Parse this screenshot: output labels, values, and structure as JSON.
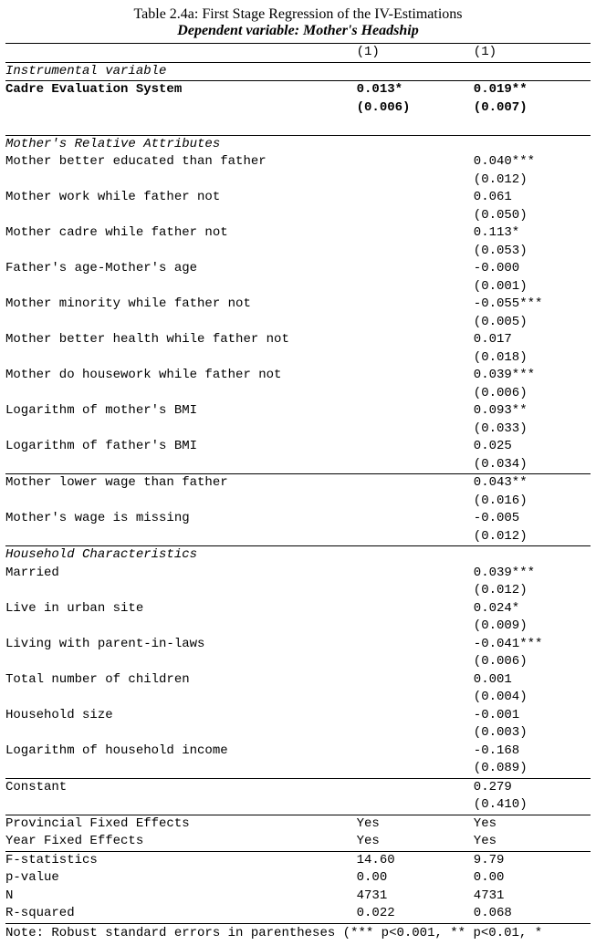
{
  "header": {
    "title": "Table 2.4a: First Stage Regression of the IV-Estimations",
    "subtitle": "Dependent variable: Mother's Headship"
  },
  "cols": {
    "c1": "(1)",
    "c2": "(1)"
  },
  "iv": {
    "heading": "Instrumental variable",
    "row": {
      "label": "Cadre Evaluation System",
      "v1": "0.013*",
      "v2": "0.019**",
      "se1": "(0.006)",
      "se2": "(0.007)"
    }
  },
  "relattr": {
    "heading": "Mother's Relative Attributes",
    "rows": [
      {
        "label": "Mother better educated than father",
        "v2": "0.040***",
        "se2": "(0.012)"
      },
      {
        "label": "Mother work while father not",
        "v2": "0.061",
        "se2": "(0.050)"
      },
      {
        "label": "Mother cadre while father not",
        "v2": "0.113*",
        "se2": "(0.053)"
      },
      {
        "label": "Father's age-Mother's age",
        "v2": "-0.000",
        "se2": "(0.001)"
      },
      {
        "label": "Mother minority while father not",
        "v2": "-0.055***",
        "se2": "(0.005)"
      },
      {
        "label": "Mother better health while father not",
        "v2": "0.017",
        "se2": "(0.018)"
      },
      {
        "label": "Mother do housework while father not",
        "v2": "0.039***",
        "se2": "(0.006)"
      },
      {
        "label": "Logarithm of mother's BMI",
        "v2": "0.093**",
        "se2": "(0.033)"
      },
      {
        "label": "Logarithm of father's BMI",
        "v2": "0.025",
        "se2": "(0.034)"
      }
    ]
  },
  "wage": {
    "rows": [
      {
        "label": "Mother lower wage than father",
        "v2": "0.043**",
        "se2": "(0.016)"
      },
      {
        "label": "Mother's wage is missing",
        "v2": "-0.005",
        "se2": "(0.012)"
      }
    ]
  },
  "hh": {
    "heading": "Household Characteristics",
    "rows": [
      {
        "label": "Married",
        "v2": "0.039***",
        "se2": "(0.012)"
      },
      {
        "label": "Live in urban site",
        "v2": "0.024*",
        "se2": "(0.009)"
      },
      {
        "label": "Living with parent-in-laws",
        "v2": "-0.041***",
        "se2": "(0.006)"
      },
      {
        "label": "Total number of children",
        "v2": "0.001",
        "se2": "(0.004)"
      },
      {
        "label": "Household size",
        "v2": "-0.001",
        "se2": "(0.003)"
      },
      {
        "label": "Logarithm of household income",
        "v2": "-0.168",
        "se2": "(0.089)"
      }
    ]
  },
  "constant": {
    "label": "Constant",
    "v2": "0.279",
    "se2": "(0.410)"
  },
  "fe": {
    "rows": [
      {
        "label": "Provincial Fixed Effects",
        "v1": "Yes",
        "v2": "Yes"
      },
      {
        "label": "Year Fixed Effects",
        "v1": "Yes",
        "v2": "Yes"
      }
    ]
  },
  "stats": {
    "rows": [
      {
        "label": "F-statistics",
        "v1": "14.60",
        "v2": "9.79"
      },
      {
        "label": "p-value",
        "v1": "0.00",
        "v2": "0.00"
      },
      {
        "label": "N",
        "v1": "4731",
        "v2": "4731"
      },
      {
        "label": "R-squared",
        "v1": "0.022",
        "v2": "0.068"
      }
    ]
  },
  "note": "Note: Robust standard errors in parentheses (*** p<0.001, ** p<0.01, *"
}
